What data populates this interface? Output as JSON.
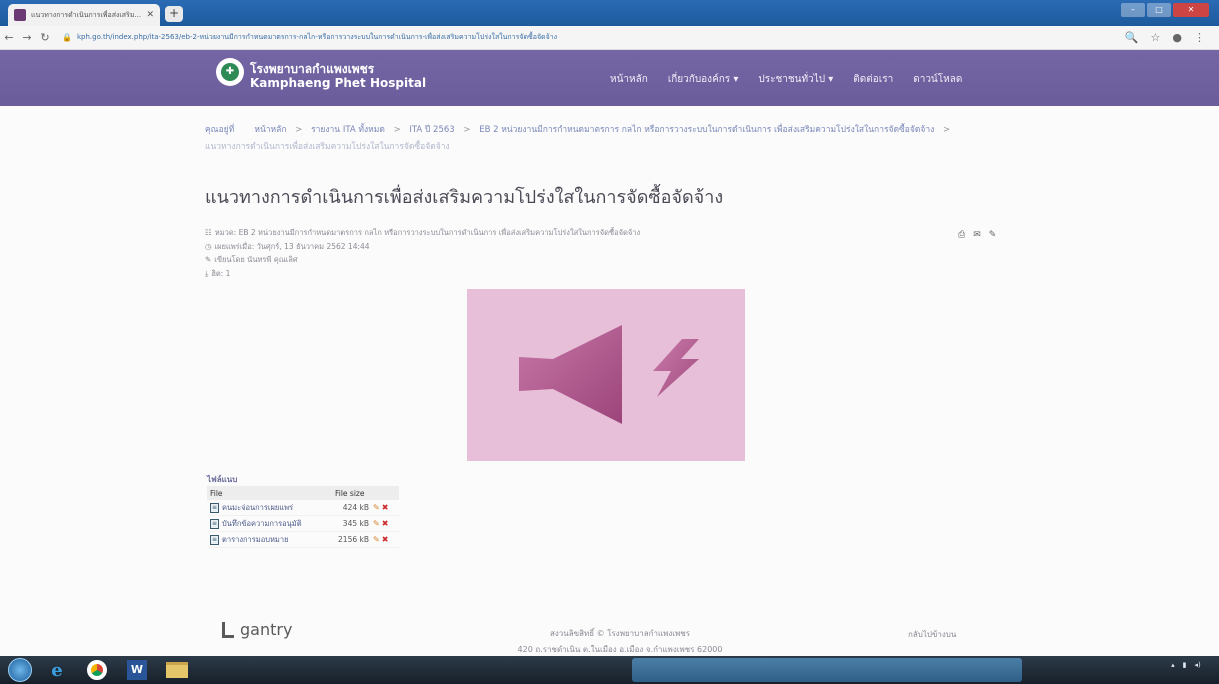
{
  "browser": {
    "tab_title": "แนวทางการดำเนินการเพื่อส่งเสริม...",
    "url": "kph.go.th/index.php/ita-2563/eb-2-หน่วยงานมีการกำหนดมาตรการ-กลไก-หรือการวางระบบในการดำเนินการ-เพื่อส่งเสริมความโปร่งใสในการจัดซื้อจัดจ้าง"
  },
  "site": {
    "name_th": "โรงพยาบาลกำแพงเพชร",
    "name_en": "Kamphaeng Phet Hospital",
    "menu": [
      "หน้าหลัก",
      "เกี่ยวกับองค์กร ▾",
      "ประชาชนทั่วไป ▾",
      "ติดต่อเรา",
      "ดาวน์โหลด"
    ]
  },
  "breadcrumb": {
    "items": [
      "คุณอยู่ที่",
      "หน้าหลัก",
      "รายงาน ITA ทั้งหมด",
      "ITA ปี 2563",
      "EB 2 หน่วยงานมีการกำหนดมาตรการ กลไก หรือการวางระบบในการดำเนินการ เพื่อส่งเสริมความโปร่งใสในการจัดซื้อจัดจ้าง"
    ],
    "last": "แนวทางการดำเนินการเพื่อส่งเสริมความโปร่งใสในการจัดซื้อจัดจ้าง"
  },
  "article": {
    "title": "แนวทางการดำเนินการเพื่อส่งเสริมความโปร่งใสในการจัดซื้อจัดจ้าง",
    "category": "หมวด: EB 2 หน่วยงานมีการกำหนดมาตรการ กลไก หรือการวางระบบในการดำเนินการ เพื่อส่งเสริมความโปร่งใสในการจัดซื้อจัดจ้าง",
    "published": "เผยแพร่เมื่อ: วันศุกร์, 13 ธันวาคม 2562 14:44",
    "author": "เขียนโดย นันทรพี คุณเลิศ",
    "hits": "ฮิต: 1"
  },
  "attachments": {
    "title": "ไฟล์แนบ",
    "col_file": "File",
    "col_size": "File size",
    "files": [
      {
        "name": "คนมะจ่อนการเผยแพร่",
        "size": "424 kB"
      },
      {
        "name": "บันทึกข้อความการอนุมัติ",
        "size": "345 kB"
      },
      {
        "name": "ตารางการมอบหมาย",
        "size": "2156 kB"
      }
    ]
  },
  "footer": {
    "brand": "gantry",
    "copyright": "สงวนลิขสิทธิ์ © โรงพยาบาลกำแพงเพชร",
    "address": "420 ถ.ราชดำเนิน ต.ในเมือง อ.เมือง จ.กำแพงเพชร 62000",
    "back_to_top": "กลับไปข้างบน"
  },
  "colors": {
    "header_bg": "#6b5c9c",
    "hero_bg": "#e8bfd8",
    "hero_shape": "#b04f8a"
  }
}
